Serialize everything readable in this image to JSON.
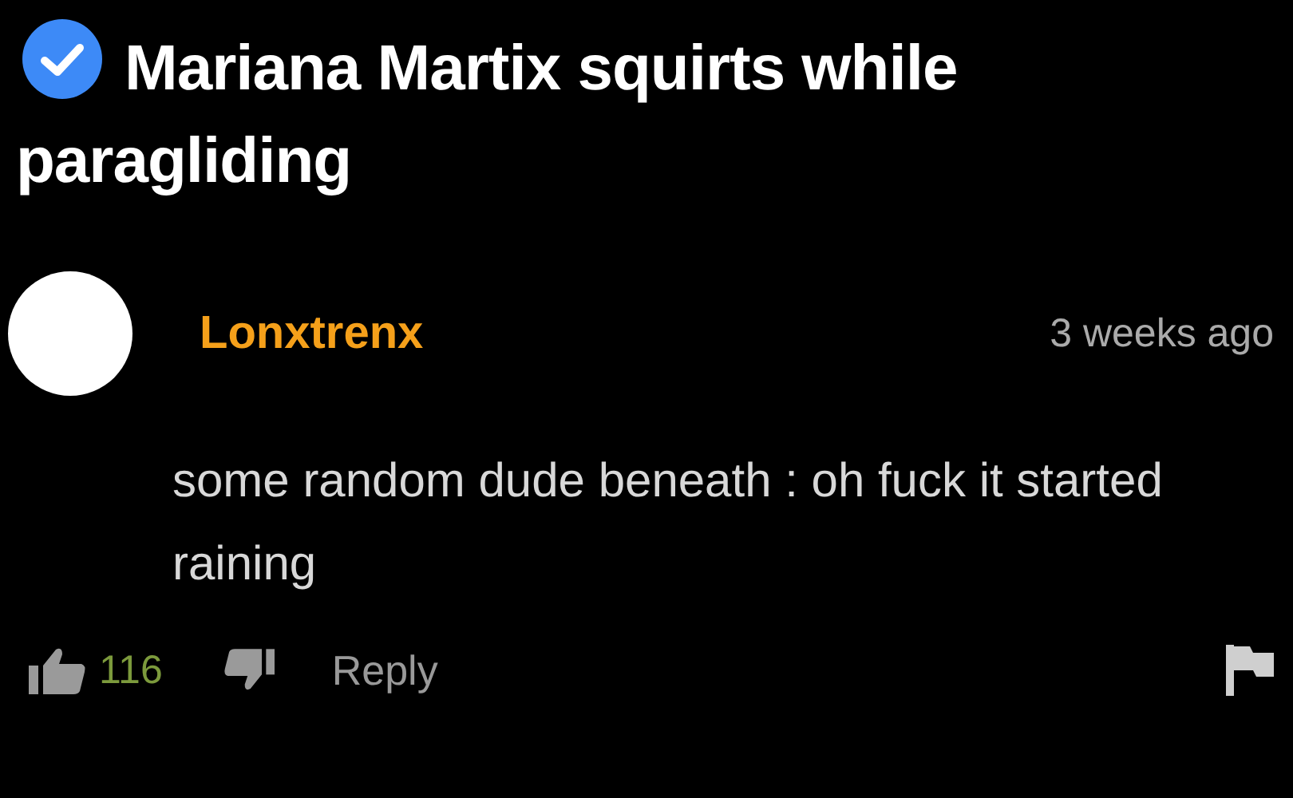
{
  "video": {
    "title": "Mariana Martix squirts while paragliding",
    "verified": true
  },
  "comment": {
    "author": "Lonxtrenx",
    "time": "3 weeks ago",
    "text": "some random dude beneath : oh fuck it started raining",
    "likes": "116",
    "reply": "Reply"
  }
}
